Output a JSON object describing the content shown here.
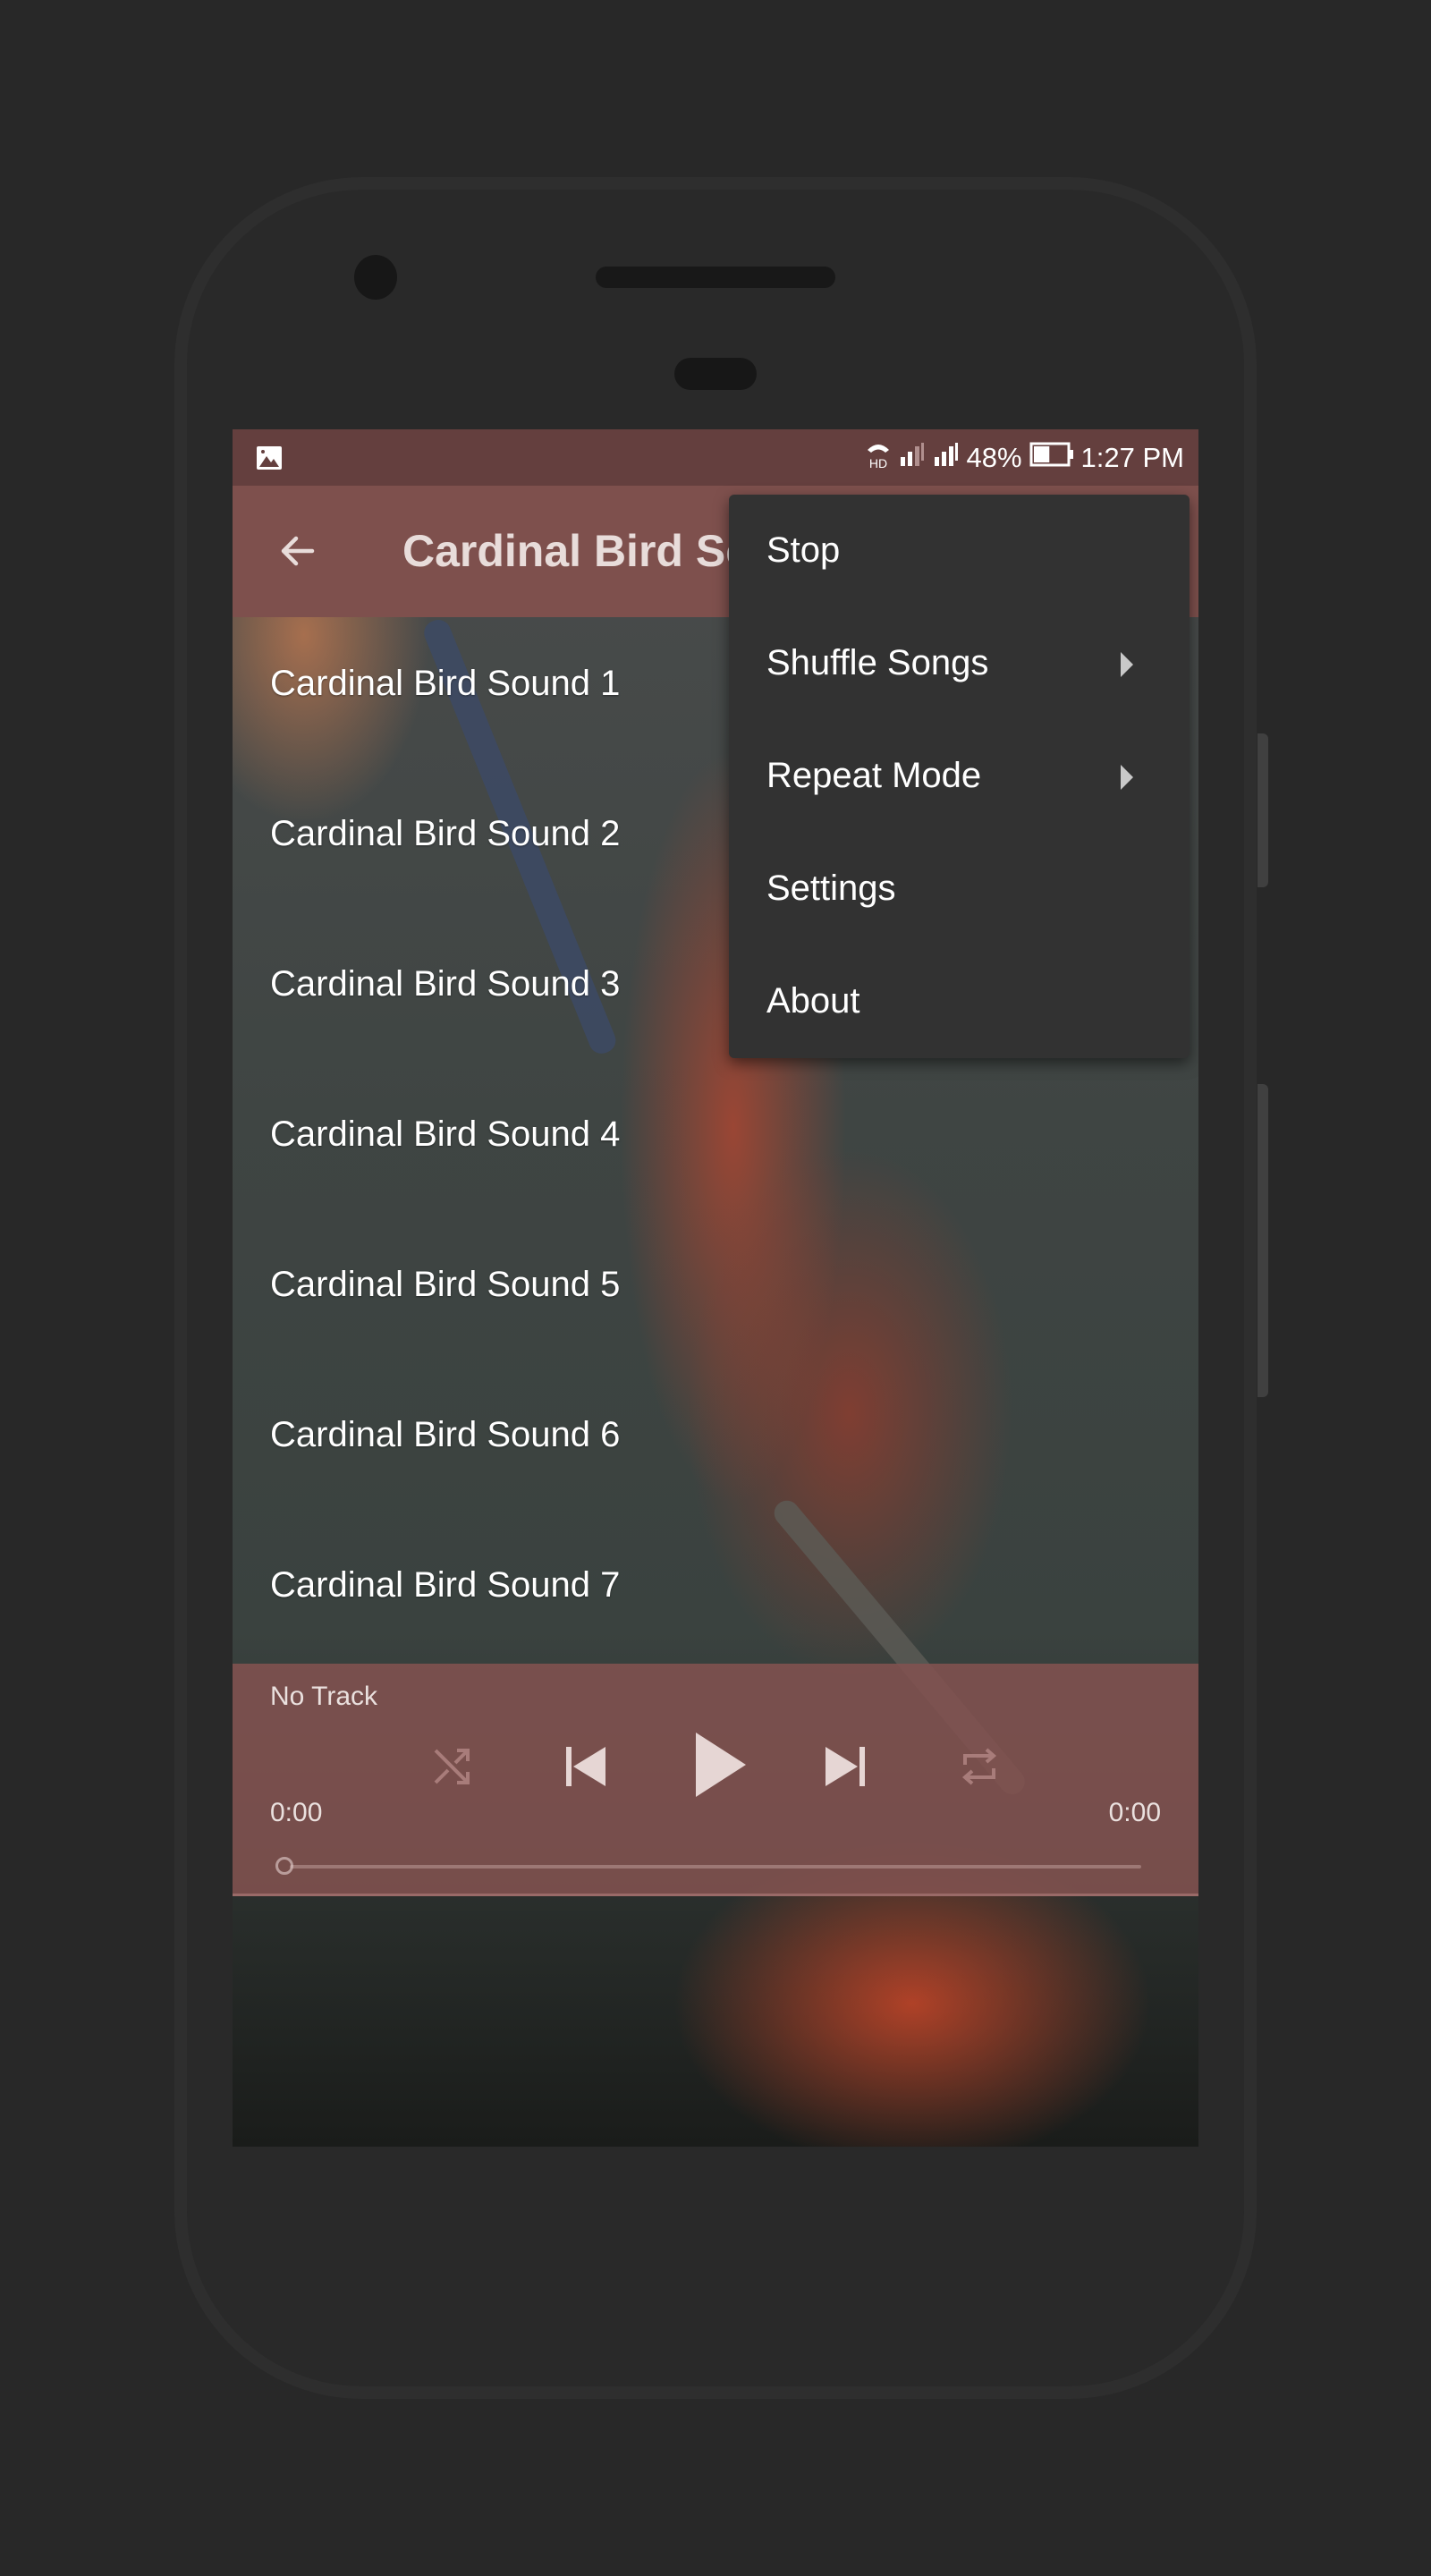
{
  "status_bar": {
    "left_icon": "image-icon",
    "network_label": "HD",
    "battery_percent": "48%",
    "battery_level": 0.48,
    "time": "1:27 PM"
  },
  "app_bar": {
    "back_icon": "arrow-left-icon",
    "title": "Cardinal Bird Sounds"
  },
  "sound_list": [
    {
      "label": "Cardinal Bird Sound 1"
    },
    {
      "label": "Cardinal Bird Sound 2"
    },
    {
      "label": "Cardinal Bird Sound 3"
    },
    {
      "label": "Cardinal Bird Sound 4"
    },
    {
      "label": "Cardinal Bird Sound 5"
    },
    {
      "label": "Cardinal Bird Sound 6"
    },
    {
      "label": "Cardinal Bird Sound 7"
    }
  ],
  "overflow_menu": {
    "items": [
      {
        "label": "Stop",
        "has_submenu": false
      },
      {
        "label": "Shuffle Songs",
        "has_submenu": true
      },
      {
        "label": "Repeat Mode",
        "has_submenu": true
      },
      {
        "label": "Settings",
        "has_submenu": false
      },
      {
        "label": "About",
        "has_submenu": false
      }
    ]
  },
  "player": {
    "track_title": "No Track",
    "elapsed": "0:00",
    "duration": "0:00",
    "progress": 0,
    "controls": [
      "shuffle-icon",
      "skip-previous-icon",
      "play-icon",
      "skip-next-icon",
      "repeat-icon"
    ]
  },
  "colors": {
    "status_bar": "#643f3e",
    "app_bar": "#7e504d",
    "menu_bg": "#323232",
    "player_bg": "#825250",
    "device_body": "#292929"
  }
}
